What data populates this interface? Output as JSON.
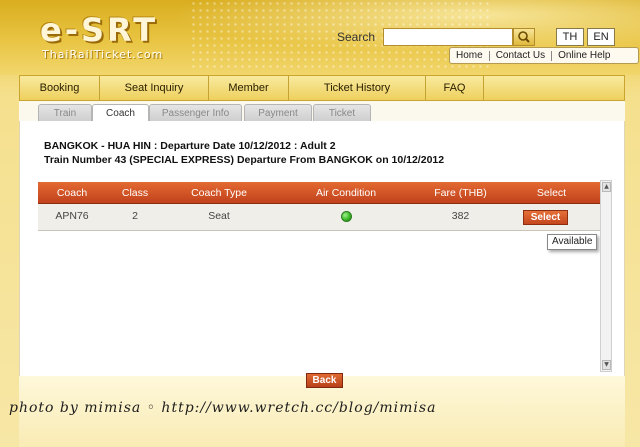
{
  "brand": {
    "logo_main": "e-SRT",
    "logo_sub": "ThaiRailTicket.com"
  },
  "search": {
    "label": "Search",
    "value": ""
  },
  "languages": [
    "TH",
    "EN"
  ],
  "top_links": [
    "Home",
    "Contact Us",
    "Online Help"
  ],
  "nav": [
    "Booking",
    "Seat Inquiry",
    "Member",
    "Ticket History",
    "FAQ"
  ],
  "steps": [
    {
      "label": "Train",
      "active": false
    },
    {
      "label": "Coach",
      "active": true
    },
    {
      "label": "Passenger Info",
      "active": false
    },
    {
      "label": "Payment",
      "active": false
    },
    {
      "label": "Ticket",
      "active": false
    }
  ],
  "journey": {
    "line1": "BANGKOK - HUA HIN : Departure Date 10/12/2012 : Adult 2",
    "line2": "Train Number 43 (SPECIAL EXPRESS) Departure From BANGKOK on 10/12/2012"
  },
  "table": {
    "headers": [
      "Coach",
      "Class",
      "Coach Type",
      "Air Condition",
      "Fare (THB)",
      "Select"
    ],
    "rows": [
      {
        "coach": "APN76",
        "class": "2",
        "type": "Seat",
        "air": "green-dot-icon",
        "fare": "382",
        "select_label": "Select"
      }
    ]
  },
  "tooltip": "Available",
  "back_label": "Back",
  "watermark": "photo by mimisa ◦ http://www.wretch.cc/blog/mimisa",
  "colors": {
    "header_accent": "#c1411c",
    "nav_gold": "#eed05e",
    "status_green": "#34b320"
  }
}
